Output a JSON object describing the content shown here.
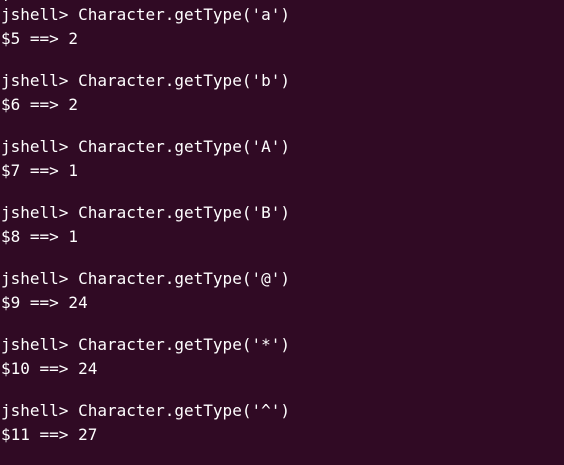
{
  "terminal": {
    "clipped_top": "|",
    "entries": [
      {
        "prompt": "jshell> Character.getType('a')",
        "result": "$5 ==> 2"
      },
      {
        "prompt": "jshell> Character.getType('b')",
        "result": "$6 ==> 2"
      },
      {
        "prompt": "jshell> Character.getType('A')",
        "result": "$7 ==> 1"
      },
      {
        "prompt": "jshell> Character.getType('B')",
        "result": "$8 ==> 1"
      },
      {
        "prompt": "jshell> Character.getType('@')",
        "result": "$9 ==> 24"
      },
      {
        "prompt": "jshell> Character.getType('*')",
        "result": "$10 ==> 24"
      },
      {
        "prompt": "jshell> Character.getType('^')",
        "result": "$11 ==> 27"
      }
    ]
  }
}
